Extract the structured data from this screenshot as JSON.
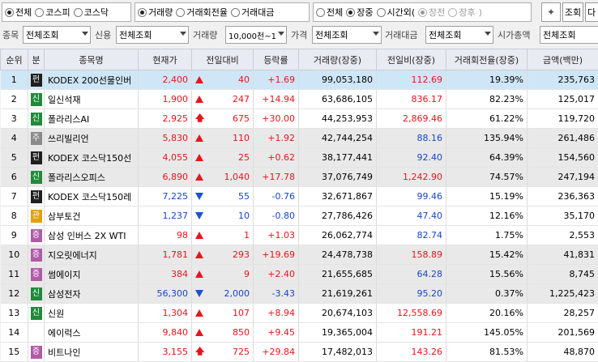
{
  "toolbar": {
    "market_group": [
      "전체",
      "코스피",
      "코스닥"
    ],
    "sort_group": [
      "거래량",
      "거래회전율",
      "거래대금"
    ],
    "session_group": [
      "전체",
      "장중",
      "시간외("
    ],
    "session_sub": [
      "장전",
      "장후",
      ")"
    ],
    "search_label": "조회",
    "next_label": "다"
  },
  "filters": {
    "stock_label": "종목",
    "stock_value": "전체조회",
    "credit_label": "신용",
    "credit_value": "전체조회",
    "volume_label": "거래량",
    "volume_value": "10,000천~1",
    "price_label": "가격",
    "price_value": "전체조회",
    "amount_label": "거래대금",
    "amount_value": "전체조회",
    "mcap_label": "시가총액",
    "mcap_value": "전체조회"
  },
  "table": {
    "headers": [
      "순위",
      "분",
      "종목명",
      "현재가",
      "전일대비",
      "등락률",
      "거래량(장중)",
      "전일비(장중)",
      "거래회전율(장중)",
      "금액(백만)"
    ],
    "rows": [
      {
        "rank": "1",
        "tag": "펀",
        "tag_color": "#1f1f1f",
        "name": "KODEX 200선물인버",
        "price": "2,400",
        "dir": "up",
        "change": "40",
        "rate": "+1.69",
        "volume": "99,053,180",
        "prev_ratio": "112.69",
        "ratio_color": "red",
        "turnover": "19.39%",
        "amount": "235,763",
        "style": "sel"
      },
      {
        "rank": "2",
        "tag": "신",
        "tag_color": "#1f8a3a",
        "name": "일신석재",
        "price": "1,900",
        "dir": "up",
        "change": "247",
        "rate": "+14.94",
        "volume": "63,686,105",
        "prev_ratio": "836.17",
        "ratio_color": "red",
        "turnover": "82.23%",
        "amount": "125,017",
        "style": "w"
      },
      {
        "rank": "3",
        "tag": "신",
        "tag_color": "#1f8a3a",
        "name": "폴라리스AI",
        "price": "2,925",
        "dir": "limit",
        "change": "675",
        "rate": "+30.00",
        "volume": "44,253,953",
        "prev_ratio": "2,869.46",
        "ratio_color": "red",
        "turnover": "61.22%",
        "amount": "119,720",
        "style": "w"
      },
      {
        "rank": "4",
        "tag": "주",
        "tag_color": "#8a8a8a",
        "name": "쓰리빌리언",
        "price": "5,830",
        "dir": "up",
        "change": "110",
        "rate": "+1.92",
        "volume": "42,744,254",
        "prev_ratio": "88.16",
        "ratio_color": "blue",
        "turnover": "135.94%",
        "amount": "261,486",
        "style": "alt"
      },
      {
        "rank": "5",
        "tag": "펀",
        "tag_color": "#1f1f1f",
        "name": "KODEX 코스닥150선",
        "price": "4,055",
        "dir": "up",
        "change": "25",
        "rate": "+0.62",
        "volume": "38,177,441",
        "prev_ratio": "92.40",
        "ratio_color": "blue",
        "turnover": "64.39%",
        "amount": "154,560",
        "style": "alt"
      },
      {
        "rank": "6",
        "tag": "신",
        "tag_color": "#1f8a3a",
        "name": "폴라리스오피스",
        "price": "6,890",
        "dir": "up",
        "change": "1,040",
        "rate": "+17.78",
        "volume": "37,076,749",
        "prev_ratio": "1,242.90",
        "ratio_color": "red",
        "turnover": "74.57%",
        "amount": "247,194",
        "style": "alt"
      },
      {
        "rank": "7",
        "tag": "펀",
        "tag_color": "#1f1f1f",
        "name": "KODEX 코스닥150레",
        "price": "7,225",
        "dir": "dn",
        "change": "55",
        "rate": "-0.76",
        "volume": "32,671,867",
        "prev_ratio": "99.46",
        "ratio_color": "blue",
        "turnover": "15.19%",
        "amount": "236,363",
        "style": "w"
      },
      {
        "rank": "8",
        "tag": "관",
        "tag_color": "#e0a000",
        "name": "삼부토건",
        "price": "1,237",
        "dir": "dn",
        "change": "10",
        "rate": "-0.80",
        "volume": "27,786,426",
        "prev_ratio": "47.40",
        "ratio_color": "blue",
        "turnover": "12.16%",
        "amount": "35,170",
        "style": "w"
      },
      {
        "rank": "9",
        "tag": "증",
        "tag_color": "#b05aa8",
        "name": "삼성 인버스 2X WTI",
        "price": "98",
        "dir": "up",
        "change": "1",
        "rate": "+1.03",
        "volume": "26,062,774",
        "prev_ratio": "82.74",
        "ratio_color": "blue",
        "turnover": "1.75%",
        "amount": "2,553",
        "style": "w"
      },
      {
        "rank": "10",
        "tag": "증",
        "tag_color": "#b05aa8",
        "name": "지오릿에너지",
        "price": "1,781",
        "dir": "up",
        "change": "293",
        "rate": "+19.69",
        "volume": "24,478,738",
        "prev_ratio": "158.89",
        "ratio_color": "red",
        "turnover": "15.42%",
        "amount": "41,831",
        "style": "alt"
      },
      {
        "rank": "11",
        "tag": "증",
        "tag_color": "#b05aa8",
        "name": "썸에이지",
        "price": "384",
        "dir": "up",
        "change": "9",
        "rate": "+2.40",
        "volume": "21,655,685",
        "prev_ratio": "64.28",
        "ratio_color": "blue",
        "turnover": "15.56%",
        "amount": "8,745",
        "style": "alt"
      },
      {
        "rank": "12",
        "tag": "신",
        "tag_color": "#1f8a3a",
        "name": "삼성전자",
        "price": "56,300",
        "dir": "dn",
        "change": "2,000",
        "rate": "-3.43",
        "volume": "21,619,261",
        "prev_ratio": "95.20",
        "ratio_color": "blue",
        "turnover": "0.37%",
        "amount": "1,225,423",
        "style": "alt"
      },
      {
        "rank": "13",
        "tag": "신",
        "tag_color": "#1f8a3a",
        "name": "신원",
        "price": "1,304",
        "dir": "up",
        "change": "107",
        "rate": "+8.94",
        "volume": "20,674,103",
        "prev_ratio": "12,558.69",
        "ratio_color": "red",
        "turnover": "20.16%",
        "amount": "28,257",
        "style": "w"
      },
      {
        "rank": "14",
        "tag": "",
        "tag_color": "",
        "name": "에이럭스",
        "price": "9,840",
        "dir": "up",
        "change": "850",
        "rate": "+9.45",
        "volume": "19,365,004",
        "prev_ratio": "191.21",
        "ratio_color": "red",
        "turnover": "145.05%",
        "amount": "201,569",
        "style": "w"
      },
      {
        "rank": "15",
        "tag": "증",
        "tag_color": "#b05aa8",
        "name": "비트나인",
        "price": "3,155",
        "dir": "limit",
        "change": "725",
        "rate": "+29.84",
        "volume": "17,482,013",
        "prev_ratio": "143.26",
        "ratio_color": "red",
        "turnover": "81.53%",
        "amount": "48,870",
        "style": "w"
      }
    ]
  },
  "colors": {
    "up": "#e8141b",
    "down": "#1746c8",
    "selected_row": "#cfe6f7",
    "alt_row": "#e9e9e9"
  }
}
